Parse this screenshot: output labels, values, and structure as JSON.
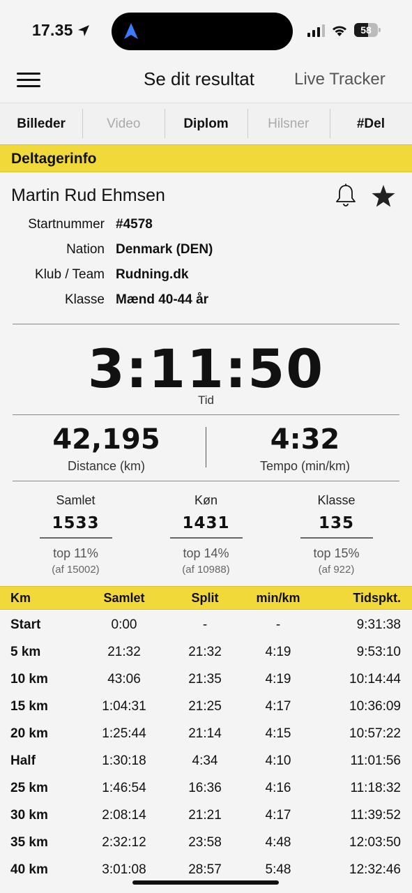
{
  "status": {
    "time": "17.35",
    "battery": "58",
    "battery_level": 0.58
  },
  "header": {
    "title": "Se dit resultat",
    "live_tracker": "Live Tracker"
  },
  "tabs": [
    {
      "label": "Billeder",
      "enabled": true
    },
    {
      "label": "Video",
      "enabled": false
    },
    {
      "label": "Diplom",
      "enabled": true
    },
    {
      "label": "Hilsner",
      "enabled": false
    },
    {
      "label": "#Del",
      "enabled": true
    }
  ],
  "section": {
    "participant": "Deltagerinfo"
  },
  "athlete": {
    "name": "Martin Rud Ehmsen",
    "fields": [
      {
        "label": "Startnummer",
        "value": "#4578"
      },
      {
        "label": "Nation",
        "value": "Denmark (DEN)"
      },
      {
        "label": "Klub / Team",
        "value": "Rudning.dk"
      },
      {
        "label": "Klasse",
        "value": "Mænd 40-44 år"
      }
    ]
  },
  "result": {
    "time": "3:11:50",
    "time_label": "Tid",
    "distance": "42,195",
    "distance_label": "Distance (km)",
    "pace": "4:32",
    "pace_label": "Tempo (min/km)"
  },
  "rankings": [
    {
      "title": "Samlet",
      "value": "1533",
      "top": "top 11%",
      "of": "(af 15002)"
    },
    {
      "title": "Køn",
      "value": "1431",
      "top": "top 14%",
      "of": "(af 10988)"
    },
    {
      "title": "Klasse",
      "value": "135",
      "top": "top 15%",
      "of": "(af 922)"
    }
  ],
  "splits": {
    "headers": [
      "Km",
      "Samlet",
      "Split",
      "min/km",
      "Tidspkt."
    ],
    "rows": [
      [
        "Start",
        "0:00",
        "-",
        "-",
        "9:31:38"
      ],
      [
        "5 km",
        "21:32",
        "21:32",
        "4:19",
        "9:53:10"
      ],
      [
        "10 km",
        "43:06",
        "21:35",
        "4:19",
        "10:14:44"
      ],
      [
        "15 km",
        "1:04:31",
        "21:25",
        "4:17",
        "10:36:09"
      ],
      [
        "20 km",
        "1:25:44",
        "21:14",
        "4:15",
        "10:57:22"
      ],
      [
        "Half",
        "1:30:18",
        "4:34",
        "4:10",
        "11:01:56"
      ],
      [
        "25 km",
        "1:46:54",
        "16:36",
        "4:16",
        "11:18:32"
      ],
      [
        "30 km",
        "2:08:14",
        "21:21",
        "4:17",
        "11:39:52"
      ],
      [
        "35 km",
        "2:32:12",
        "23:58",
        "4:48",
        "12:03:50"
      ],
      [
        "40 km",
        "3:01:08",
        "28:57",
        "5:48",
        "12:32:46"
      ]
    ]
  },
  "icons": {
    "menu": "menu-icon",
    "bell": "bell-icon",
    "star": "star-icon",
    "location": "location-arrow-icon"
  }
}
